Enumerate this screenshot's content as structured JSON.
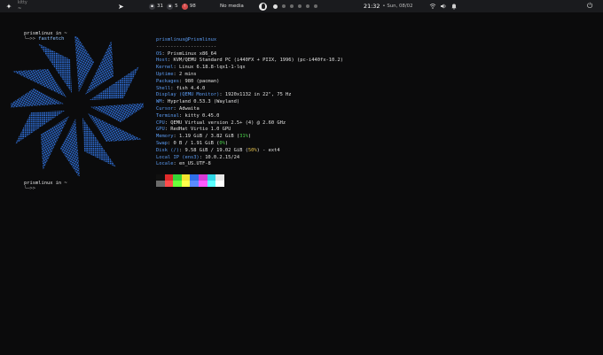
{
  "topbar": {
    "logo_icon": "hyprland-star-icon",
    "window_title": "kitty",
    "window_subtitle": "~",
    "stats": [
      {
        "icon": "cpu-icon",
        "value": "31",
        "color": "#3a3b40"
      },
      {
        "icon": "memory-icon",
        "value": "5",
        "color": "#3a3b40"
      },
      {
        "icon": "disk-icon",
        "value": "98",
        "color": "#d64b4b"
      }
    ],
    "media": "No media",
    "workspaces": [
      true,
      false,
      false,
      false,
      false,
      false
    ],
    "time": "21:32",
    "date": "• Sun, 08/02"
  },
  "terminal": {
    "prompt1_host": "prismlinux in ~",
    "prompt1_arrow": "└─>>",
    "prompt1_cmd": " fastfetch",
    "prompt2_host": "prismlinux in ~",
    "prompt2_arrow": "└─>>",
    "logo_color": "#2f6fd8"
  },
  "sysinfo": {
    "header": "prismlinux@Prismlinux",
    "separator": "---------------------",
    "rows": [
      {
        "key": "OS",
        "value": "PrismLinux x86_64"
      },
      {
        "key": "Host",
        "value": "KVM/QEMU Standard PC (i440FX + PIIX, 1996) (pc-i440fx-10.2)"
      },
      {
        "key": "Kernel",
        "value": "Linux 6.18.8-lqx1-1-lqx"
      },
      {
        "key": "Uptime",
        "value": "2 mins"
      },
      {
        "key": "Packages",
        "value": "980 (pacman)"
      },
      {
        "key": "Shell",
        "value": "fish 4.4.0"
      },
      {
        "key": "Display (QEMU Monitor)",
        "value": "1920x1132 in 22\", 75 Hz"
      },
      {
        "key": "WM",
        "value": "Hyprland 0.53.3 (Wayland)"
      },
      {
        "key": "Cursor",
        "value": "Adwaita"
      },
      {
        "key": "Terminal",
        "value": "kitty 0.45.0"
      },
      {
        "key": "CPU",
        "value": "QEMU Virtual version 2.5+ (4) @ 2.60 GHz"
      },
      {
        "key": "GPU",
        "value": "RedHat Virtio 1.0 GPU"
      },
      {
        "key": "Memory",
        "value_pre": "1.19 GiB / 3.82 GiB (",
        "value_hi": "31%",
        "value_post": ")",
        "hi_color": "#4ad04a"
      },
      {
        "key": "Swap",
        "value_pre": "0 B / 1.91 GiB (",
        "value_hi": "0%",
        "value_post": ")",
        "hi_color": "#4ad04a"
      },
      {
        "key": "Disk (/)",
        "value_pre": "9.58 GiB / 19.02 GiB (",
        "value_hi": "50%",
        "value_post": ") - ext4",
        "hi_color": "#e6c34d"
      },
      {
        "key": "Local IP (ens3)",
        "value": "10.0.2.15/24"
      },
      {
        "key": "Locale",
        "value": "en_US.UTF-8"
      }
    ],
    "palette": [
      "#101010",
      "#e02b2b",
      "#36d436",
      "#f2e52e",
      "#2f6fe8",
      "#d63bd6",
      "#2fd6e6",
      "#e6e6e6",
      "#6b6b6b",
      "#ff4b4b",
      "#6bff3b",
      "#ffff4b",
      "#5b8bff",
      "#ff5bff",
      "#5bffff",
      "#ffffff"
    ]
  }
}
